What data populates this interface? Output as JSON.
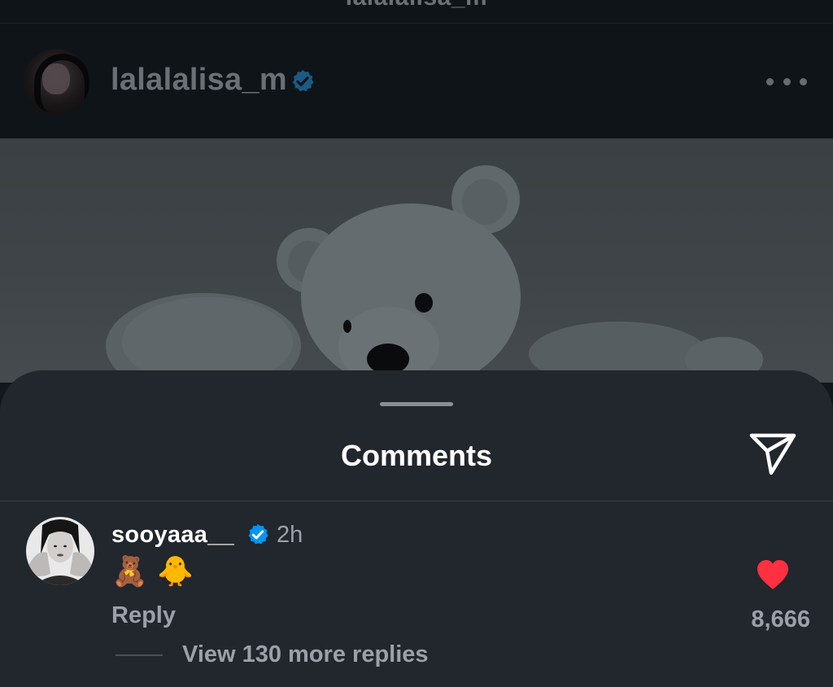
{
  "top_nav": {
    "title": "lalalalisa_m"
  },
  "post": {
    "username": "lalalalisa_m",
    "verified_icon": "verified-badge-icon",
    "more_icon": "more-options-icon",
    "image_subject": "white teddy bear"
  },
  "comments_sheet": {
    "title": "Comments",
    "share_icon": "send-icon",
    "comment": {
      "username": "sooyaaa__",
      "verified_icon": "verified-badge-icon",
      "time": "2h",
      "text": "🧸 🐥",
      "reply_label": "Reply",
      "like_icon": "heart-icon",
      "like_count": "8,666",
      "view_replies_label": "View 130 more replies"
    }
  },
  "colors": {
    "sheet_background": "#22262d",
    "verified_blue": "#0095f6",
    "like_red": "#ff3040",
    "secondary_text": "#9ba1a8"
  }
}
